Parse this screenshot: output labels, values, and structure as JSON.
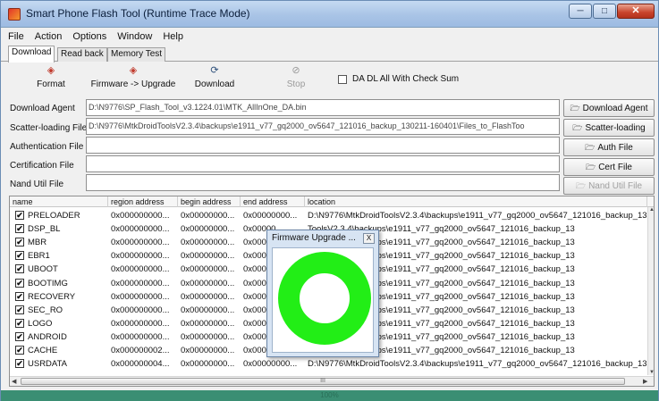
{
  "window": {
    "title": "Smart Phone Flash Tool (Runtime Trace Mode)"
  },
  "menu": [
    "File",
    "Action",
    "Options",
    "Window",
    "Help"
  ],
  "tabs": [
    "Download",
    "Read back",
    "Memory Test"
  ],
  "toolbar": {
    "format": "Format",
    "firmware_upgrade": "Firmware -> Upgrade",
    "download": "Download",
    "stop": "Stop",
    "checksum_label": "DA DL All With Check Sum"
  },
  "fields": {
    "download_agent": {
      "label": "Download Agent",
      "value": "D:\\N9776\\SP_Flash_Tool_v3.1224.01\\MTK_AllInOne_DA.bin",
      "button": "Download Agent"
    },
    "scatter": {
      "label": "Scatter-loading File",
      "value": "D:\\N9776\\MtkDroidToolsV2.3.4\\backups\\e1911_v77_gq2000_ov5647_121016_backup_130211-160401\\Files_to_FlashToo",
      "button": "Scatter-loading"
    },
    "auth": {
      "label": "Authentication File",
      "value": "",
      "button": "Auth File"
    },
    "cert": {
      "label": "Certification File",
      "value": "",
      "button": "Cert File"
    },
    "nand": {
      "label": "Nand Util File",
      "value": "",
      "button": "Nand Util File"
    }
  },
  "table": {
    "headers": [
      "name",
      "region address",
      "begin address",
      "end address",
      "location"
    ],
    "rows": [
      {
        "name": "PRELOADER",
        "region": "0x000000000...",
        "begin": "0x00000000...",
        "end": "0x00000000...",
        "location": "D:\\N9776\\MtkDroidToolsV2.3.4\\backups\\e1911_v77_gq2000_ov5647_121016_backup_13"
      },
      {
        "name": "DSP_BL",
        "region": "0x000000000...",
        "begin": "0x00000000...",
        "end": "0x00000",
        "location": "ToolsV2.3.4\\backups\\e1911_v77_gq2000_ov5647_121016_backup_13"
      },
      {
        "name": "MBR",
        "region": "0x000000000...",
        "begin": "0x00000000...",
        "end": "0x00000",
        "location": "ToolsV2.3.4\\backups\\e1911_v77_gq2000_ov5647_121016_backup_13"
      },
      {
        "name": "EBR1",
        "region": "0x000000000...",
        "begin": "0x00000000...",
        "end": "0x00000",
        "location": "ToolsV2.3.4\\backups\\e1911_v77_gq2000_ov5647_121016_backup_13"
      },
      {
        "name": "UBOOT",
        "region": "0x000000000...",
        "begin": "0x00000000...",
        "end": "0x00000",
        "location": "ToolsV2.3.4\\backups\\e1911_v77_gq2000_ov5647_121016_backup_13"
      },
      {
        "name": "BOOTIMG",
        "region": "0x000000000...",
        "begin": "0x00000000...",
        "end": "0x00000",
        "location": "ToolsV2.3.4\\backups\\e1911_v77_gq2000_ov5647_121016_backup_13"
      },
      {
        "name": "RECOVERY",
        "region": "0x000000000...",
        "begin": "0x00000000...",
        "end": "0x00000",
        "location": "ToolsV2.3.4\\backups\\e1911_v77_gq2000_ov5647_121016_backup_13"
      },
      {
        "name": "SEC_RO",
        "region": "0x000000000...",
        "begin": "0x00000000...",
        "end": "0x00000",
        "location": "ToolsV2.3.4\\backups\\e1911_v77_gq2000_ov5647_121016_backup_13"
      },
      {
        "name": "LOGO",
        "region": "0x000000000...",
        "begin": "0x00000000...",
        "end": "0x00000",
        "location": "ToolsV2.3.4\\backups\\e1911_v77_gq2000_ov5647_121016_backup_13"
      },
      {
        "name": "ANDROID",
        "region": "0x000000000...",
        "begin": "0x00000000...",
        "end": "0x00000",
        "location": "ToolsV2.3.4\\backups\\e1911_v77_gq2000_ov5647_121016_backup_13"
      },
      {
        "name": "CACHE",
        "region": "0x000000002...",
        "begin": "0x00000000...",
        "end": "0x00000",
        "location": "ToolsV2.3.4\\backups\\e1911_v77_gq2000_ov5647_121016_backup_13"
      },
      {
        "name": "USRDATA",
        "region": "0x000000004...",
        "begin": "0x00000000...",
        "end": "0x00000000...",
        "location": "D:\\N9776\\MtkDroidToolsV2.3.4\\backups\\e1911_v77_gq2000_ov5647_121016_backup_13"
      }
    ],
    "scroll_thumb": "III"
  },
  "popup": {
    "title": "Firmware Upgrade ...",
    "close": "X"
  },
  "status": {
    "text": "100%"
  },
  "colors": {
    "status_bar": "#3a8e73",
    "ring": "#22ee16",
    "titlebar": "#a9c4e6"
  }
}
